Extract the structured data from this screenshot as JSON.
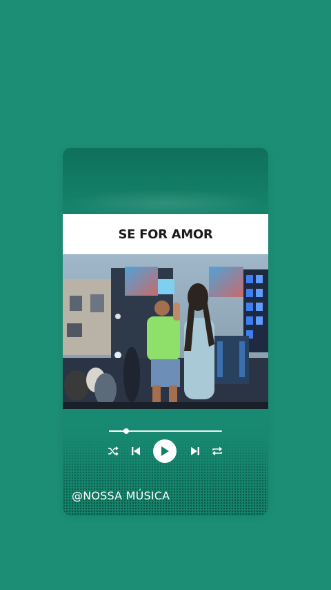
{
  "song": {
    "title": "SE FOR AMOR"
  },
  "player": {
    "progress": 0.15,
    "state": "paused",
    "controls": [
      "shuffle-icon",
      "previous-icon",
      "play-icon",
      "next-icon",
      "repeat-icon"
    ]
  },
  "footer": {
    "handle": "@NOSSA MÚSICA"
  },
  "colors": {
    "background": "#1b8e75",
    "card_dark": "#0f705b",
    "accent": "#ffffff",
    "title_text": "#1a1a1a"
  }
}
